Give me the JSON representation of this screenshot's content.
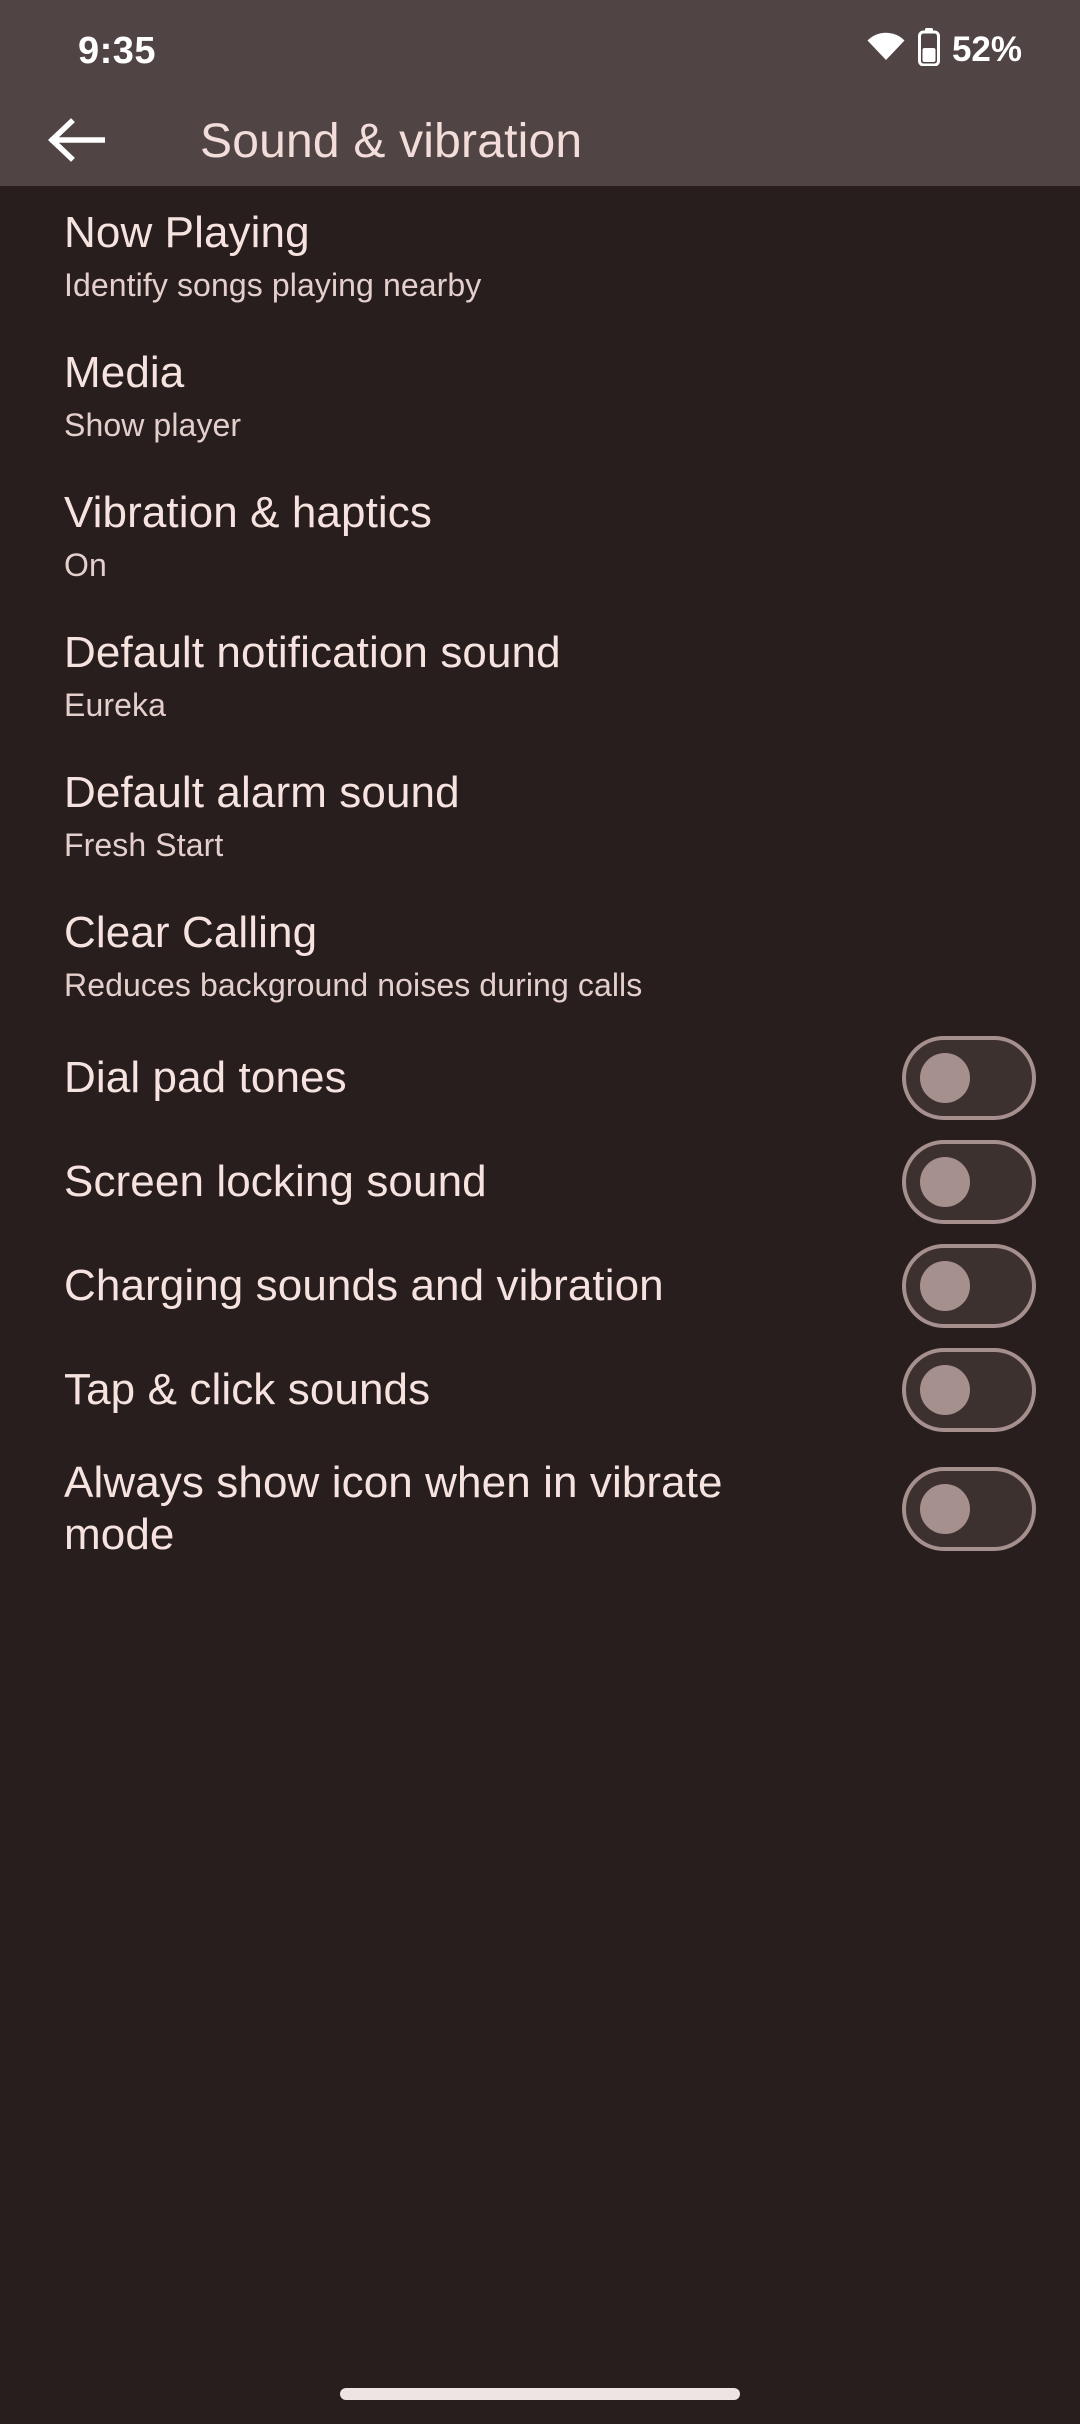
{
  "statusbar": {
    "time": "9:35",
    "battery_percent": "52%",
    "wifi_icon": "wifi-icon",
    "battery_icon": "battery-icon"
  },
  "appbar": {
    "title": "Sound & vibration",
    "back_icon": "back-arrow-icon"
  },
  "nav_items": [
    {
      "title": "Now Playing",
      "subtitle": "Identify songs playing nearby"
    },
    {
      "title": "Media",
      "subtitle": "Show player"
    },
    {
      "title": "Vibration & haptics",
      "subtitle": "On"
    },
    {
      "title": "Default notification sound",
      "subtitle": "Eureka"
    },
    {
      "title": "Default alarm sound",
      "subtitle": "Fresh Start"
    },
    {
      "title": "Clear Calling",
      "subtitle": "Reduces background noises during calls"
    }
  ],
  "toggle_items": [
    {
      "label": "Dial pad tones",
      "state": "off"
    },
    {
      "label": "Screen locking sound",
      "state": "off"
    },
    {
      "label": "Charging sounds and vibration",
      "state": "off"
    },
    {
      "label": "Tap & click sounds",
      "state": "off"
    },
    {
      "label": "Always show icon when in vibrate mode",
      "state": "off"
    }
  ],
  "colors": {
    "status_bar_bg": "#504444",
    "body_bg": "#271e1d",
    "title_text": "#f6e3e0",
    "subtitle_text": "#e4cfcc",
    "switch_outline": "#a6908e",
    "nav_handle": "#ece5e3"
  },
  "nav_handle": {
    "name": "gesture-nav-handle"
  }
}
